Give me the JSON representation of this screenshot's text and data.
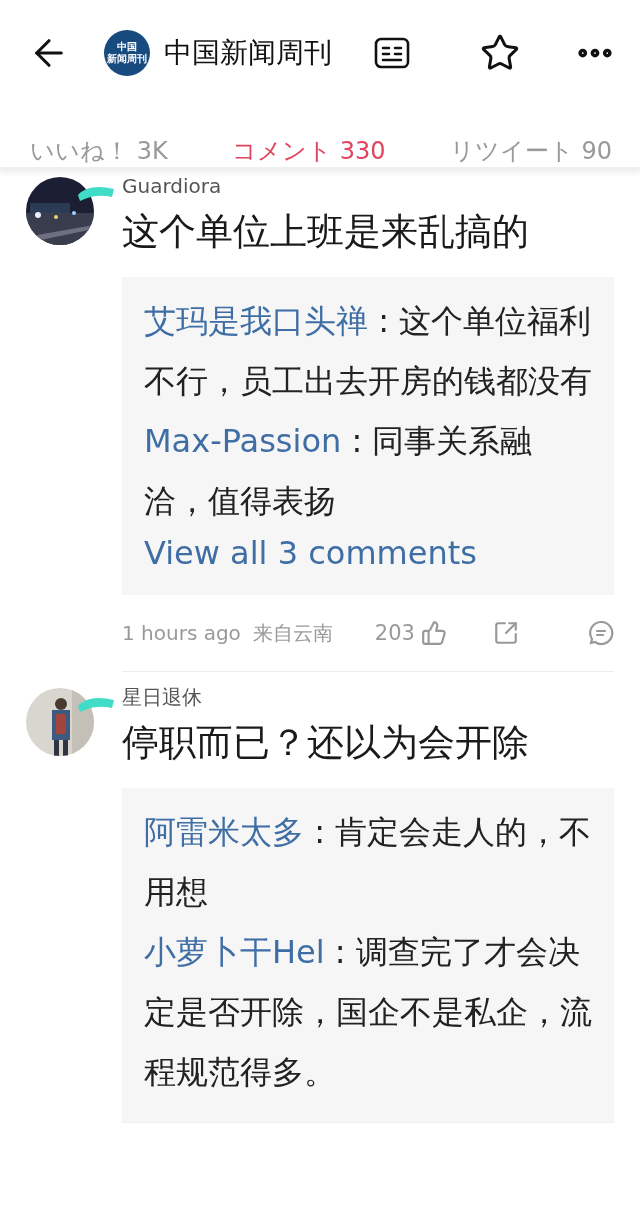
{
  "header": {
    "logo": [
      "中国",
      "新闻周刊"
    ],
    "title": "中国新闻周刊"
  },
  "tabs": [
    {
      "label": "いいね！ 3K",
      "selected": false
    },
    {
      "label": "コメント 330",
      "selected": true
    },
    {
      "label": "リツイート 90",
      "selected": false
    }
  ],
  "comments": [
    {
      "avatar": {
        "kind": "picture"
      },
      "username": "Guardiora",
      "text": "这个单位上班是来乱搞的",
      "replies": [
        {
          "user": "艾玛是我口头禅",
          "text": ": 这个单位福利不行，员工出去开房的钱都没有"
        },
        {
          "user": "Max-Passion",
          "text": ": 同事关系融洽，值得表扬"
        }
      ],
      "view_all": "View all 3 comments",
      "time": "1 hours ago",
      "location": "来自云南",
      "likes": "203"
    },
    {
      "avatar": {
        "kind": "picture"
      },
      "username": "星日退休",
      "text": "停职而已？还以为会开除",
      "replies": [
        {
          "user": "阿雷米太多",
          "text": ": 肯定会走人的，不用想"
        },
        {
          "user": "小萝卜干Hel",
          "text": ": 调查完了才会决定是否开除，国企不是私企，流程规范得多。"
        }
      ]
    }
  ]
}
